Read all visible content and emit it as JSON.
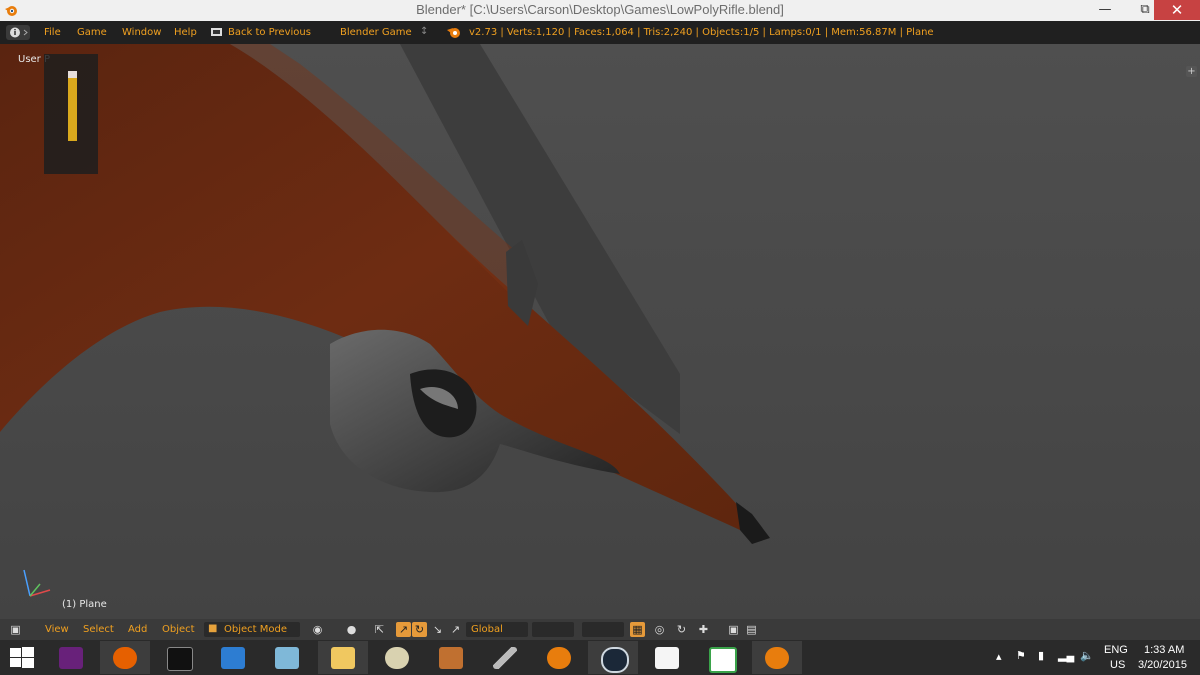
{
  "window": {
    "title": "Blender* [C:\\Users\\Carson\\Desktop\\Games\\LowPolyRifle.blend]",
    "minimize_glyph": "—",
    "maximize_glyph": "⧉",
    "close_glyph": "✕"
  },
  "info_header": {
    "menus": [
      "File",
      "Game",
      "Window",
      "Help"
    ],
    "back_label": "Back to Previous",
    "engine": "Blender Game",
    "stats": "v2.73 | Verts:1,120 | Faces:1,064 | Tris:2,240 | Objects:1/5 | Lamps:0/1 | Mem:56.87M | Plane"
  },
  "viewport": {
    "view_label": "User P",
    "plus_glyph": "+",
    "object_label": "(1) Plane"
  },
  "view_header": {
    "menus": [
      "View",
      "Select",
      "Add",
      "Object"
    ],
    "mode": "Object Mode",
    "orientation": "Global"
  },
  "taskbar": {
    "apps": [
      "windows-start",
      "visual-studio",
      "firefox",
      "command-prompt",
      "remote-desktop",
      "notepad",
      "file-explorer",
      "paint",
      "paint-net",
      "inkscape-pen",
      "blender",
      "steam",
      "media-player",
      "camtasia",
      "blender-active"
    ],
    "lang_top": "ENG",
    "lang_bottom": "US",
    "time": "1:33 AM",
    "date": "3/20/2015"
  },
  "colors": {
    "accent": "#f0a020",
    "wood": "#6b2a10",
    "viewport_bg": "#4a4a4a"
  }
}
